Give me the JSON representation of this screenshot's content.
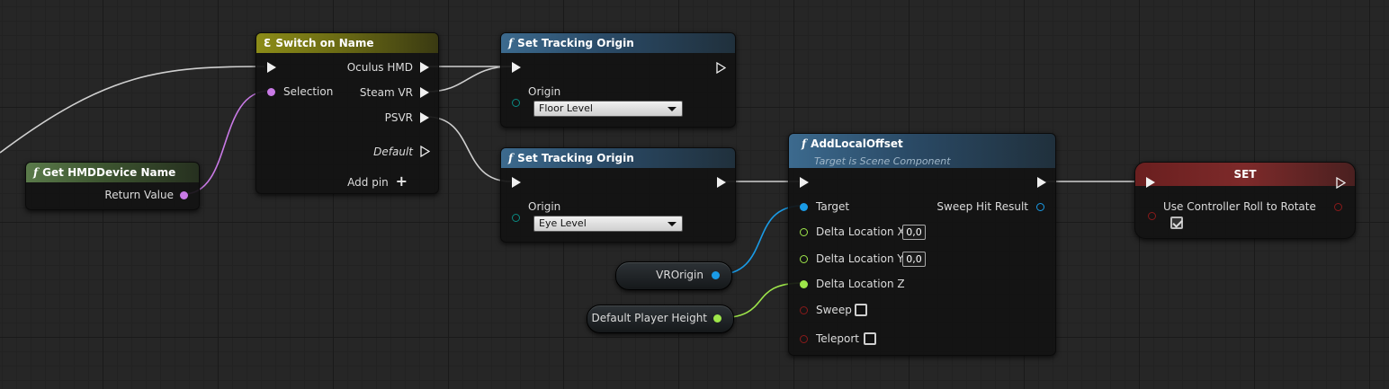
{
  "colors": {
    "exec": "#f0f0f0",
    "name_pin": "#c97ae6",
    "object_pin": "#1a9be6",
    "float_pin": "#9ee64a",
    "bool_pin": "#8a1a1a",
    "struct_pin": "#1a9be6",
    "enum_pin": "#0a6e6a"
  },
  "nodes": {
    "get_hmd": {
      "title": "Get HMDDevice Name",
      "return_label": "Return Value"
    },
    "switch": {
      "title": "Switch on Name",
      "selection_label": "Selection",
      "outputs": [
        "Oculus HMD",
        "Steam VR",
        "PSVR"
      ],
      "default_label": "Default",
      "add_pin_label": "Add pin"
    },
    "set_tracking_1": {
      "title": "Set Tracking Origin",
      "origin_label": "Origin",
      "origin_value": "Floor Level"
    },
    "set_tracking_2": {
      "title": "Set Tracking Origin",
      "origin_label": "Origin",
      "origin_value": "Eye Level"
    },
    "add_local_offset": {
      "title": "AddLocalOffset",
      "subtitle": "Target is Scene Component",
      "target_label": "Target",
      "sweep_hit_label": "Sweep Hit Result",
      "delta_x_label": "Delta Location X",
      "delta_x_value": "0,0",
      "delta_y_label": "Delta Location Y",
      "delta_y_value": "0,0",
      "delta_z_label": "Delta Location Z",
      "sweep_label": "Sweep",
      "sweep_checked": false,
      "teleport_label": "Teleport",
      "teleport_checked": false
    },
    "set_var": {
      "title": "SET",
      "var_label": "Use Controller Roll to Rotate",
      "var_checked": true
    },
    "vr_origin": {
      "label": "VROrigin"
    },
    "default_player_height": {
      "label": "Default Player Height"
    }
  }
}
